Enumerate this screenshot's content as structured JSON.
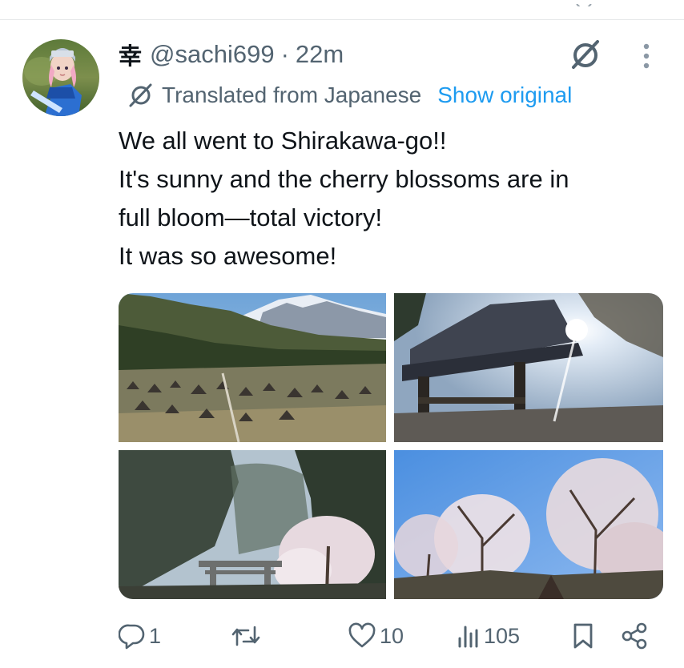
{
  "tweet": {
    "display_name": "幸",
    "handle": "@sachi699",
    "separator": "·",
    "time": "22m",
    "translated_label": "Translated from Japanese",
    "show_original_label": "Show original",
    "text_lines": [
      "We all went to Shirakawa-go!!",
      "It's sunny and the cherry blossoms are in",
      "full bloom—total victory!",
      "It was so awesome!"
    ],
    "media": [
      {
        "icon": "mountain-village-photo"
      },
      {
        "icon": "temple-gate-sun-photo"
      },
      {
        "icon": "torii-forest-photo"
      },
      {
        "icon": "cherry-blossom-photo"
      }
    ]
  },
  "actions": {
    "reply_count": "1",
    "repost_count": "",
    "like_count": "10",
    "views_count": "105"
  },
  "colors": {
    "text_primary": "#0f1419",
    "text_secondary": "#536471",
    "accent": "#1d9bf0",
    "divider": "#e7e9ea"
  }
}
